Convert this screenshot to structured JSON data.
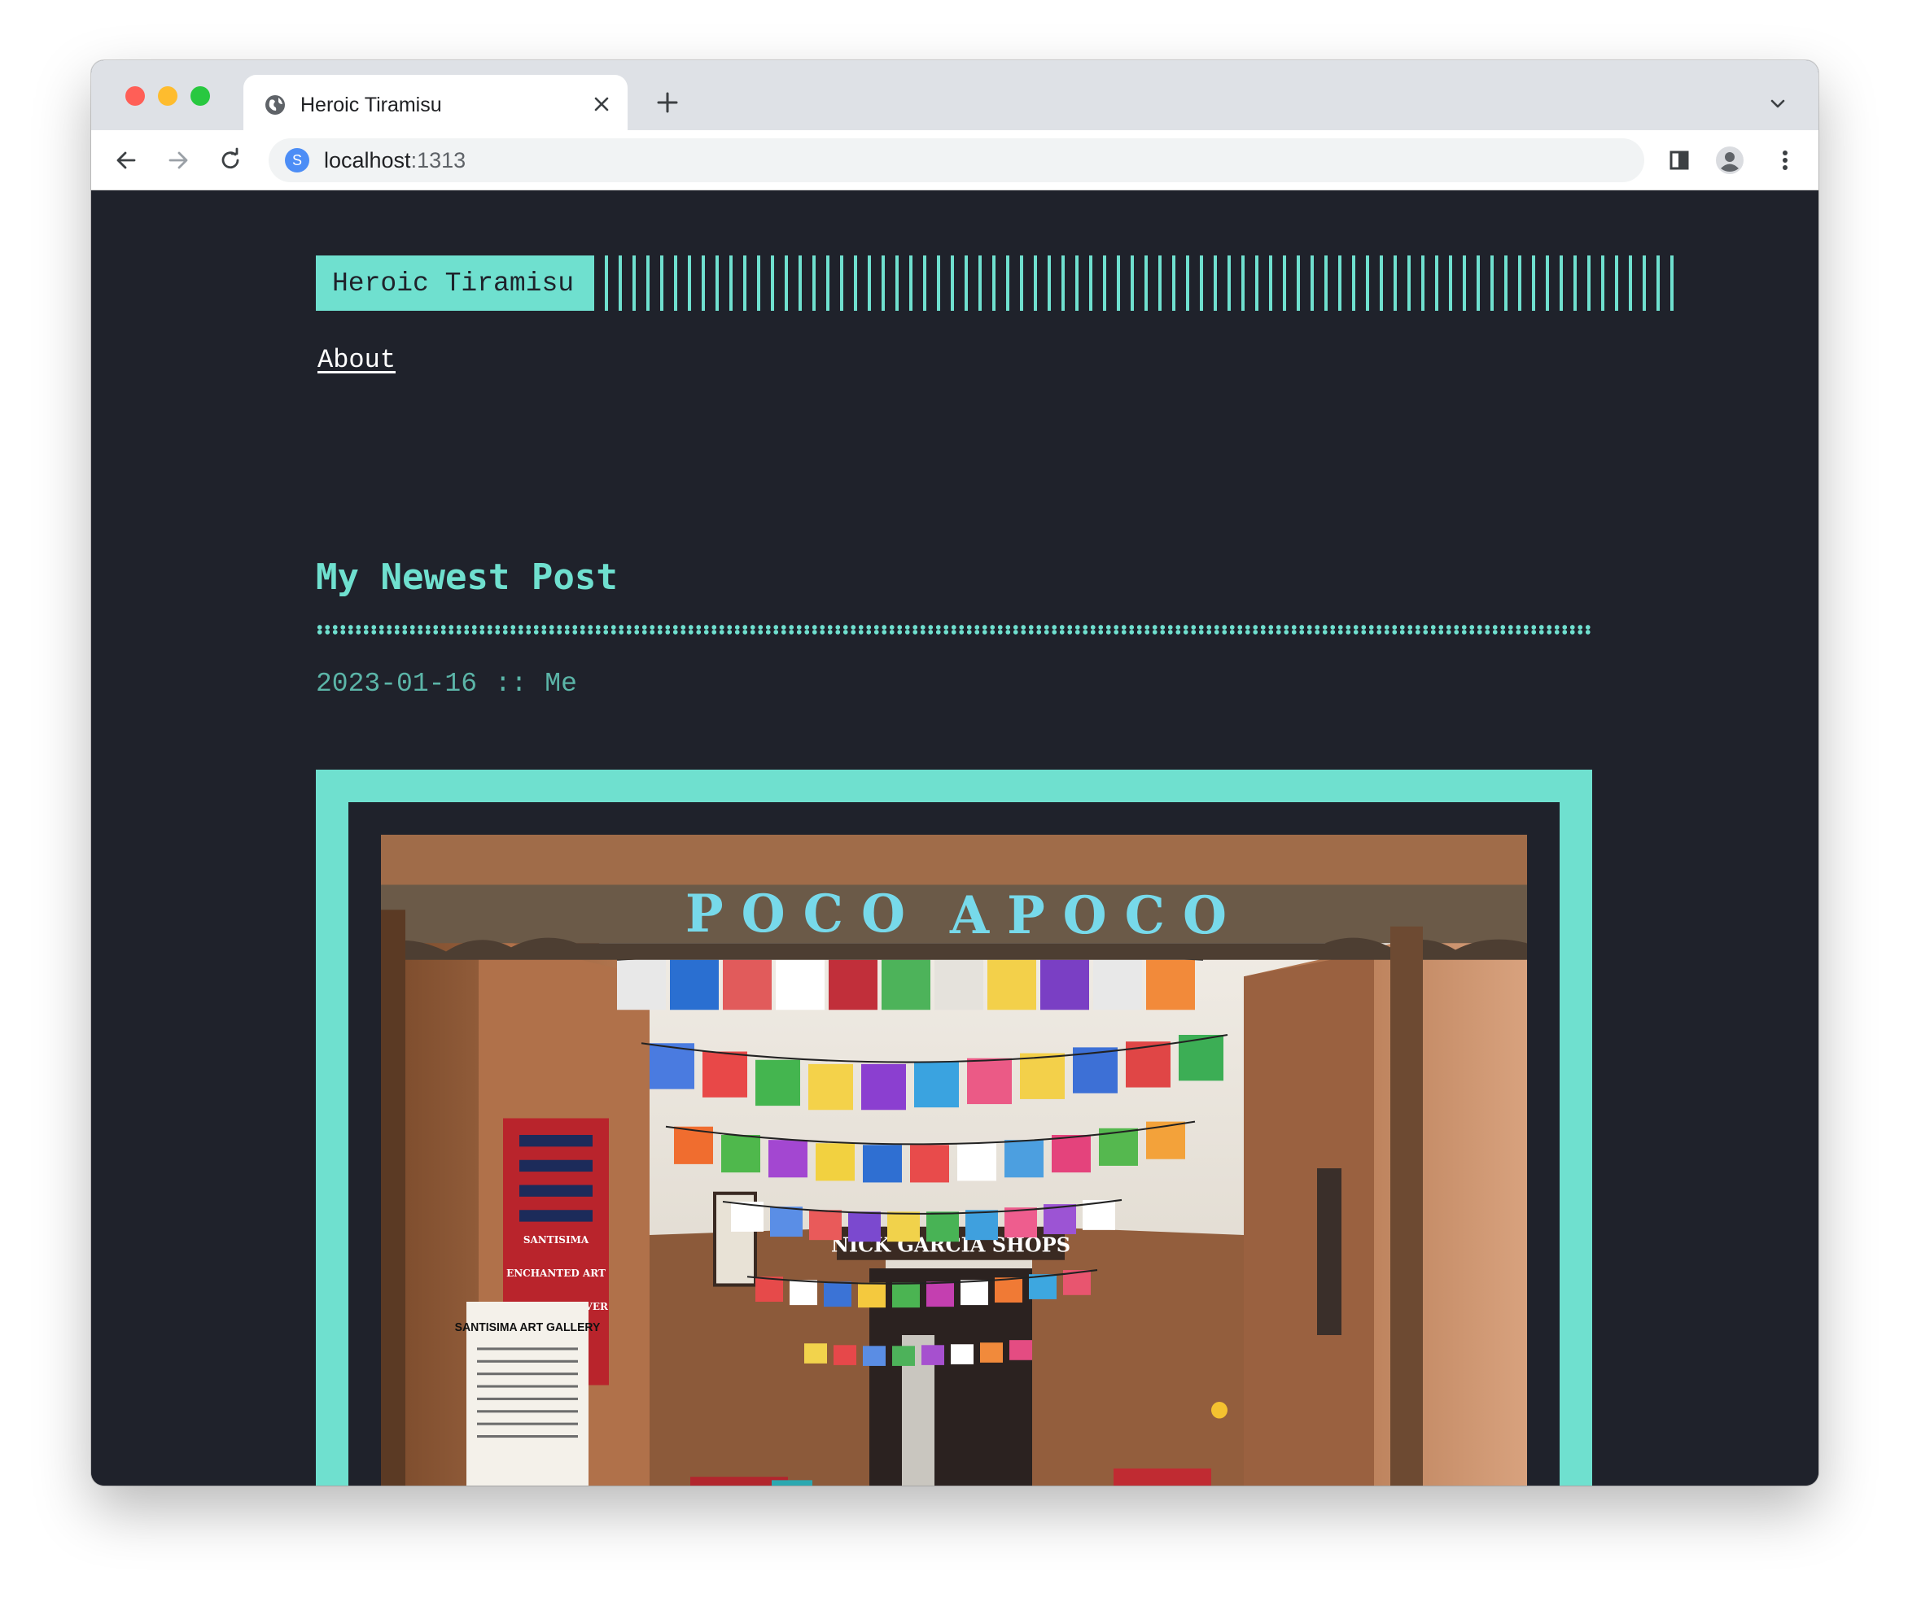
{
  "browser": {
    "tab_title": "Heroic Tiramisu",
    "url_host": "localhost",
    "url_port": ":1313",
    "site_badge": "S",
    "icons": [
      "globe-icon",
      "close-icon",
      "plus-icon",
      "chevron-down-icon",
      "back-arrow-icon",
      "forward-arrow-icon",
      "reload-icon",
      "side-panel-icon",
      "profile-icon",
      "kebab-menu-icon"
    ]
  },
  "site": {
    "logo": "Heroic Tiramisu",
    "nav": [
      {
        "label": "About"
      }
    ],
    "accent_color": "#6fe0cf",
    "background_color": "#1f222b"
  },
  "post": {
    "title": "My Newest Post",
    "date": "2023-01-16",
    "separator": "::",
    "author": "Me",
    "cover_image": {
      "sign_text": "POCO APOCO",
      "inner_sign_text": "NICK GARCIA SHOPS",
      "gallery_sign_title": "SANTISIMA ART GALLERY",
      "left_red_sign_lines": [
        "SANTISIMA",
        "ENCHANTED ART",
        "ALL TRIBE SILVER"
      ]
    }
  }
}
